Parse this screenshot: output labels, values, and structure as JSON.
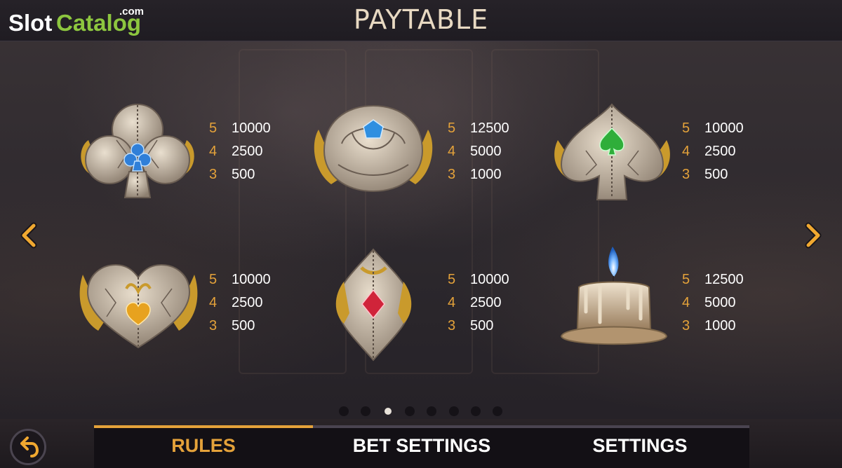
{
  "header": {
    "title": "PAYTABLE"
  },
  "logo": {
    "word1": "Slot",
    "word2": "Catalog",
    "suffix": ".com"
  },
  "symbols": [
    {
      "name": "club",
      "gem_color": "#2f7fd8",
      "pays": [
        {
          "count": "5",
          "value": "10000"
        },
        {
          "count": "4",
          "value": "2500"
        },
        {
          "count": "3",
          "value": "500"
        }
      ]
    },
    {
      "name": "rose",
      "gem_color": "#2f8fe0",
      "pays": [
        {
          "count": "5",
          "value": "12500"
        },
        {
          "count": "4",
          "value": "5000"
        },
        {
          "count": "3",
          "value": "1000"
        }
      ]
    },
    {
      "name": "spade",
      "gem_color": "#2fae3a",
      "pays": [
        {
          "count": "5",
          "value": "10000"
        },
        {
          "count": "4",
          "value": "2500"
        },
        {
          "count": "3",
          "value": "500"
        }
      ]
    },
    {
      "name": "heart",
      "gem_color": "#e7a21f",
      "pays": [
        {
          "count": "5",
          "value": "10000"
        },
        {
          "count": "4",
          "value": "2500"
        },
        {
          "count": "3",
          "value": "500"
        }
      ]
    },
    {
      "name": "diamond",
      "gem_color": "#d0243a",
      "pays": [
        {
          "count": "5",
          "value": "10000"
        },
        {
          "count": "4",
          "value": "2500"
        },
        {
          "count": "3",
          "value": "500"
        }
      ]
    },
    {
      "name": "candle",
      "gem_color": "#3f8fe8",
      "pays": [
        {
          "count": "5",
          "value": "12500"
        },
        {
          "count": "4",
          "value": "5000"
        },
        {
          "count": "3",
          "value": "1000"
        }
      ]
    }
  ],
  "pagination": {
    "total": 8,
    "current": 3
  },
  "tabs": [
    {
      "label": "RULES",
      "active": true
    },
    {
      "label": "BET SETTINGS",
      "active": false
    },
    {
      "label": "SETTINGS",
      "active": false
    }
  ],
  "colors": {
    "accent": "#e4a23a",
    "title": "#e8d9c2",
    "pay_count": "#e4a23a",
    "pay_value": "#ffffff"
  },
  "icons": {
    "prev": "chevron-left-icon",
    "next": "chevron-right-icon",
    "back": "undo-arrow-icon"
  }
}
